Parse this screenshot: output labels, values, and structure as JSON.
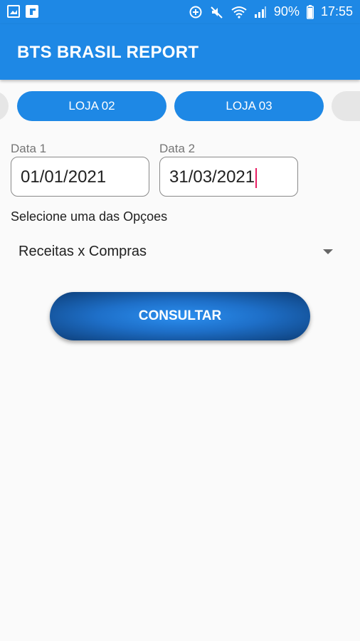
{
  "status_bar": {
    "battery": "90%",
    "time": "17:55",
    "icons": [
      "gallery-icon",
      "flipboard-icon",
      "data-saver-icon",
      "mute-icon",
      "wifi-icon",
      "signal-icon",
      "battery-icon"
    ]
  },
  "app_bar": {
    "title": "BTS BRASIL REPORT"
  },
  "tabs": [
    {
      "label": ""
    },
    {
      "label": "LOJA 02"
    },
    {
      "label": "LOJA 03"
    },
    {
      "label": ""
    }
  ],
  "form": {
    "date1_label": "Data 1",
    "date1_value": "01/01/2021",
    "date2_label": "Data 2",
    "date2_value": "31/03/2021",
    "select_prompt": "Selecione uma das Opçoes",
    "selected_option": "Receitas x Compras",
    "submit_label": "CONSULTAR"
  },
  "colors": {
    "primary": "#1e88e5",
    "button_dark": "#0d3e78",
    "caret": "#e91e63"
  }
}
